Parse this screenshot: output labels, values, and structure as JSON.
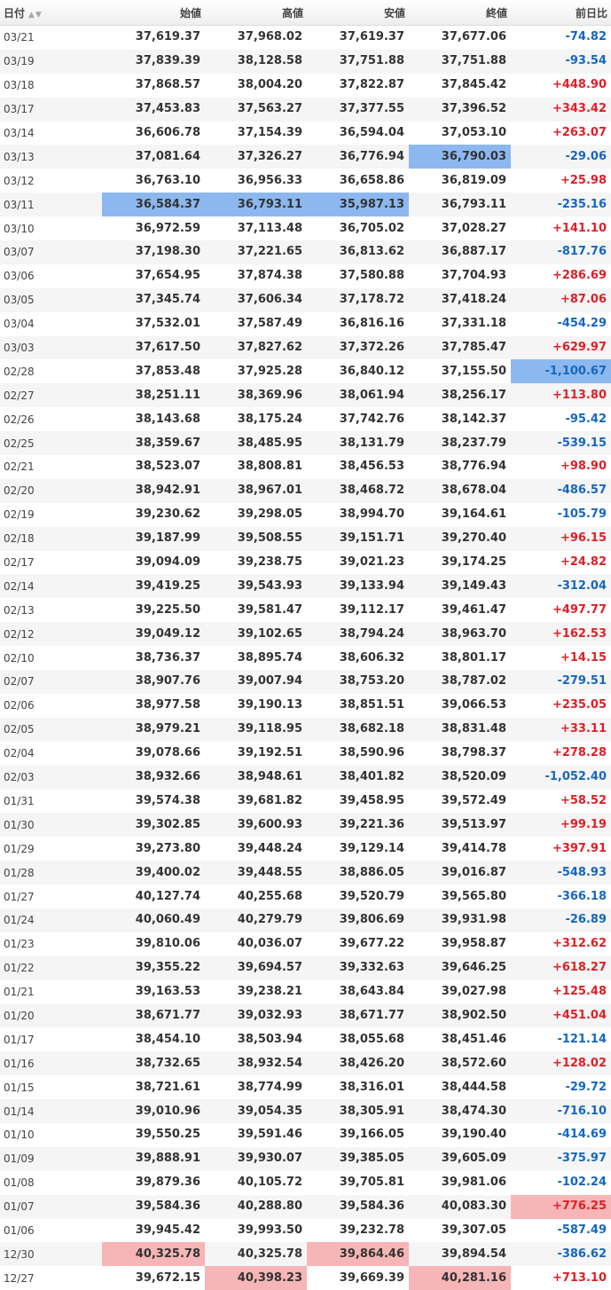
{
  "header": {
    "date": "日付",
    "sort_icon": "▲▼",
    "open": "始値",
    "high": "高値",
    "low": "安値",
    "close": "終値",
    "change": "前日比"
  },
  "colors": {
    "up": "#e01f26",
    "down": "#1567c0",
    "highlight_low": "#8cb8ef",
    "highlight_high": "#f6b5b6"
  },
  "rows": [
    {
      "date": "03/21",
      "open": "37,619.37",
      "high": "37,968.02",
      "low": "37,619.37",
      "close": "37,677.06",
      "change": "-74.82"
    },
    {
      "date": "03/19",
      "open": "37,839.39",
      "high": "38,128.58",
      "low": "37,751.88",
      "close": "37,751.88",
      "change": "-93.54"
    },
    {
      "date": "03/18",
      "open": "37,868.57",
      "high": "38,004.20",
      "low": "37,822.87",
      "close": "37,845.42",
      "change": "+448.90"
    },
    {
      "date": "03/17",
      "open": "37,453.83",
      "high": "37,563.27",
      "low": "37,377.55",
      "close": "37,396.52",
      "change": "+343.42"
    },
    {
      "date": "03/14",
      "open": "36,606.78",
      "high": "37,154.39",
      "low": "36,594.04",
      "close": "37,053.10",
      "change": "+263.07"
    },
    {
      "date": "03/13",
      "open": "37,081.64",
      "high": "37,326.27",
      "low": "36,776.94",
      "close": "36,790.03",
      "change": "-29.06",
      "hl": {
        "close": "blue"
      }
    },
    {
      "date": "03/12",
      "open": "36,763.10",
      "high": "36,956.33",
      "low": "36,658.86",
      "close": "36,819.09",
      "change": "+25.98"
    },
    {
      "date": "03/11",
      "open": "36,584.37",
      "high": "36,793.11",
      "low": "35,987.13",
      "close": "36,793.11",
      "change": "-235.16",
      "hl": {
        "open": "blue",
        "high": "blue",
        "low": "blue"
      }
    },
    {
      "date": "03/10",
      "open": "36,972.59",
      "high": "37,113.48",
      "low": "36,705.02",
      "close": "37,028.27",
      "change": "+141.10"
    },
    {
      "date": "03/07",
      "open": "37,198.30",
      "high": "37,221.65",
      "low": "36,813.62",
      "close": "36,887.17",
      "change": "-817.76"
    },
    {
      "date": "03/06",
      "open": "37,654.95",
      "high": "37,874.38",
      "low": "37,580.88",
      "close": "37,704.93",
      "change": "+286.69"
    },
    {
      "date": "03/05",
      "open": "37,345.74",
      "high": "37,606.34",
      "low": "37,178.72",
      "close": "37,418.24",
      "change": "+87.06"
    },
    {
      "date": "03/04",
      "open": "37,532.01",
      "high": "37,587.49",
      "low": "36,816.16",
      "close": "37,331.18",
      "change": "-454.29"
    },
    {
      "date": "03/03",
      "open": "37,617.50",
      "high": "37,827.62",
      "low": "37,372.26",
      "close": "37,785.47",
      "change": "+629.97"
    },
    {
      "date": "02/28",
      "open": "37,853.48",
      "high": "37,925.28",
      "low": "36,840.12",
      "close": "37,155.50",
      "change": "-1,100.67",
      "hl": {
        "change": "blue"
      }
    },
    {
      "date": "02/27",
      "open": "38,251.11",
      "high": "38,369.96",
      "low": "38,061.94",
      "close": "38,256.17",
      "change": "+113.80"
    },
    {
      "date": "02/26",
      "open": "38,143.68",
      "high": "38,175.24",
      "low": "37,742.76",
      "close": "38,142.37",
      "change": "-95.42"
    },
    {
      "date": "02/25",
      "open": "38,359.67",
      "high": "38,485.95",
      "low": "38,131.79",
      "close": "38,237.79",
      "change": "-539.15"
    },
    {
      "date": "02/21",
      "open": "38,523.07",
      "high": "38,808.81",
      "low": "38,456.53",
      "close": "38,776.94",
      "change": "+98.90"
    },
    {
      "date": "02/20",
      "open": "38,942.91",
      "high": "38,967.01",
      "low": "38,468.72",
      "close": "38,678.04",
      "change": "-486.57"
    },
    {
      "date": "02/19",
      "open": "39,230.62",
      "high": "39,298.05",
      "low": "38,994.70",
      "close": "39,164.61",
      "change": "-105.79"
    },
    {
      "date": "02/18",
      "open": "39,187.99",
      "high": "39,508.55",
      "low": "39,151.71",
      "close": "39,270.40",
      "change": "+96.15"
    },
    {
      "date": "02/17",
      "open": "39,094.09",
      "high": "39,238.75",
      "low": "39,021.23",
      "close": "39,174.25",
      "change": "+24.82"
    },
    {
      "date": "02/14",
      "open": "39,419.25",
      "high": "39,543.93",
      "low": "39,133.94",
      "close": "39,149.43",
      "change": "-312.04"
    },
    {
      "date": "02/13",
      "open": "39,225.50",
      "high": "39,581.47",
      "low": "39,112.17",
      "close": "39,461.47",
      "change": "+497.77"
    },
    {
      "date": "02/12",
      "open": "39,049.12",
      "high": "39,102.65",
      "low": "38,794.24",
      "close": "38,963.70",
      "change": "+162.53"
    },
    {
      "date": "02/10",
      "open": "38,736.37",
      "high": "38,895.74",
      "low": "38,606.32",
      "close": "38,801.17",
      "change": "+14.15"
    },
    {
      "date": "02/07",
      "open": "38,907.76",
      "high": "39,007.94",
      "low": "38,753.20",
      "close": "38,787.02",
      "change": "-279.51"
    },
    {
      "date": "02/06",
      "open": "38,977.58",
      "high": "39,190.13",
      "low": "38,851.51",
      "close": "39,066.53",
      "change": "+235.05"
    },
    {
      "date": "02/05",
      "open": "38,979.21",
      "high": "39,118.95",
      "low": "38,682.18",
      "close": "38,831.48",
      "change": "+33.11"
    },
    {
      "date": "02/04",
      "open": "39,078.66",
      "high": "39,192.51",
      "low": "38,590.96",
      "close": "38,798.37",
      "change": "+278.28"
    },
    {
      "date": "02/03",
      "open": "38,932.66",
      "high": "38,948.61",
      "low": "38,401.82",
      "close": "38,520.09",
      "change": "-1,052.40"
    },
    {
      "date": "01/31",
      "open": "39,574.38",
      "high": "39,681.82",
      "low": "39,458.95",
      "close": "39,572.49",
      "change": "+58.52"
    },
    {
      "date": "01/30",
      "open": "39,302.85",
      "high": "39,600.93",
      "low": "39,221.36",
      "close": "39,513.97",
      "change": "+99.19"
    },
    {
      "date": "01/29",
      "open": "39,273.80",
      "high": "39,448.24",
      "low": "39,129.14",
      "close": "39,414.78",
      "change": "+397.91"
    },
    {
      "date": "01/28",
      "open": "39,400.02",
      "high": "39,448.55",
      "low": "38,886.05",
      "close": "39,016.87",
      "change": "-548.93"
    },
    {
      "date": "01/27",
      "open": "40,127.74",
      "high": "40,255.68",
      "low": "39,520.79",
      "close": "39,565.80",
      "change": "-366.18"
    },
    {
      "date": "01/24",
      "open": "40,060.49",
      "high": "40,279.79",
      "low": "39,806.69",
      "close": "39,931.98",
      "change": "-26.89"
    },
    {
      "date": "01/23",
      "open": "39,810.06",
      "high": "40,036.07",
      "low": "39,677.22",
      "close": "39,958.87",
      "change": "+312.62"
    },
    {
      "date": "01/22",
      "open": "39,355.22",
      "high": "39,694.57",
      "low": "39,332.63",
      "close": "39,646.25",
      "change": "+618.27"
    },
    {
      "date": "01/21",
      "open": "39,163.53",
      "high": "39,238.21",
      "low": "38,643.84",
      "close": "39,027.98",
      "change": "+125.48"
    },
    {
      "date": "01/20",
      "open": "38,671.77",
      "high": "39,032.93",
      "low": "38,671.77",
      "close": "38,902.50",
      "change": "+451.04"
    },
    {
      "date": "01/17",
      "open": "38,454.10",
      "high": "38,503.94",
      "low": "38,055.68",
      "close": "38,451.46",
      "change": "-121.14"
    },
    {
      "date": "01/16",
      "open": "38,732.65",
      "high": "38,932.54",
      "low": "38,426.20",
      "close": "38,572.60",
      "change": "+128.02"
    },
    {
      "date": "01/15",
      "open": "38,721.61",
      "high": "38,774.99",
      "low": "38,316.01",
      "close": "38,444.58",
      "change": "-29.72"
    },
    {
      "date": "01/14",
      "open": "39,010.96",
      "high": "39,054.35",
      "low": "38,305.91",
      "close": "38,474.30",
      "change": "-716.10"
    },
    {
      "date": "01/10",
      "open": "39,550.25",
      "high": "39,591.46",
      "low": "39,166.05",
      "close": "39,190.40",
      "change": "-414.69"
    },
    {
      "date": "01/09",
      "open": "39,888.91",
      "high": "39,930.07",
      "low": "39,385.05",
      "close": "39,605.09",
      "change": "-375.97"
    },
    {
      "date": "01/08",
      "open": "39,879.36",
      "high": "40,105.72",
      "low": "39,705.81",
      "close": "39,981.06",
      "change": "-102.24"
    },
    {
      "date": "01/07",
      "open": "39,584.36",
      "high": "40,288.80",
      "low": "39,584.36",
      "close": "40,083.30",
      "change": "+776.25",
      "hl": {
        "change": "red"
      }
    },
    {
      "date": "01/06",
      "open": "39,945.42",
      "high": "39,993.50",
      "low": "39,232.78",
      "close": "39,307.05",
      "change": "-587.49"
    },
    {
      "date": "12/30",
      "open": "40,325.78",
      "high": "40,325.78",
      "low": "39,864.46",
      "close": "39,894.54",
      "change": "-386.62",
      "hl": {
        "open": "red",
        "low": "red"
      }
    },
    {
      "date": "12/27",
      "open": "39,672.15",
      "high": "40,398.23",
      "low": "39,669.39",
      "close": "40,281.16",
      "change": "+713.10",
      "hl": {
        "high": "red",
        "close": "red"
      }
    }
  ]
}
